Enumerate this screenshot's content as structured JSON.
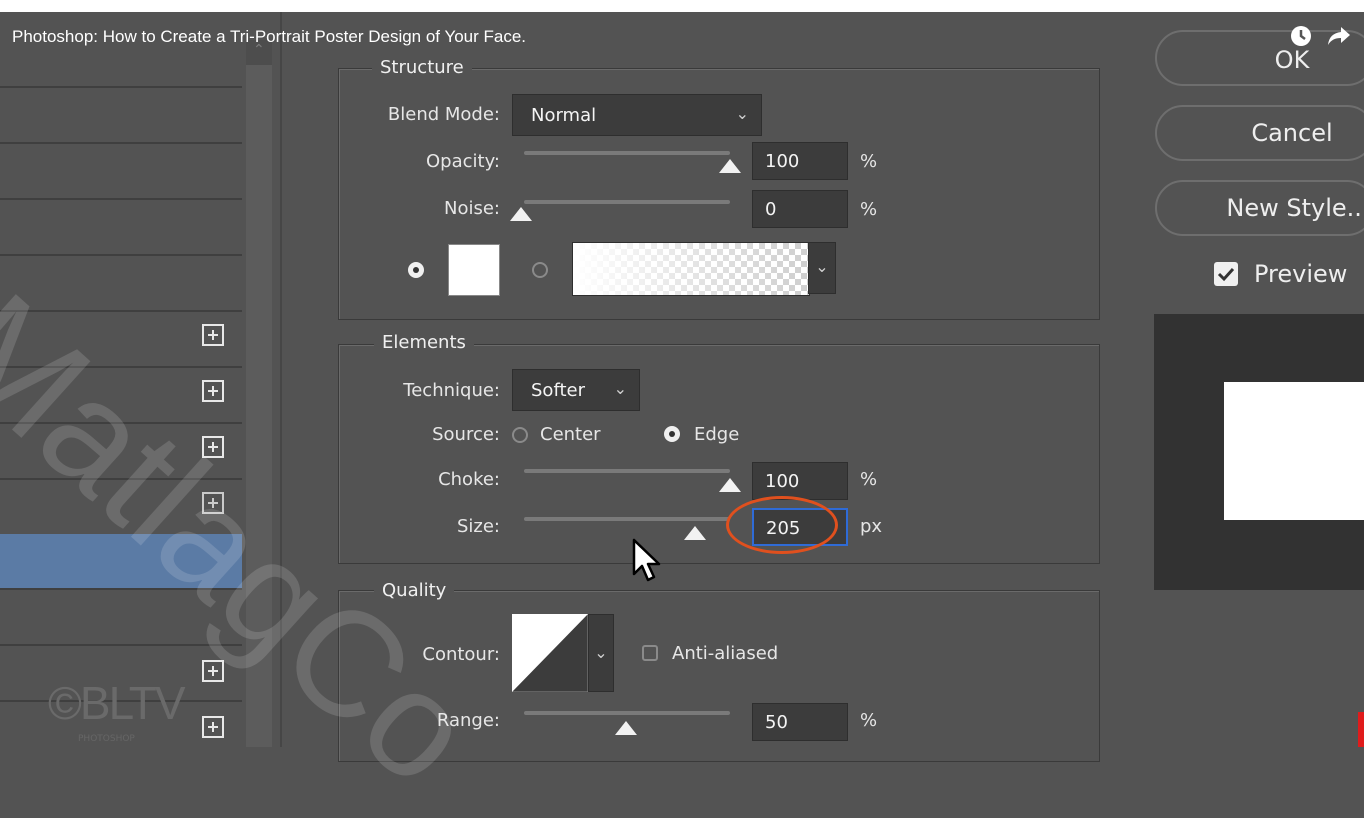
{
  "video": {
    "title": "Photoshop: How to Create a Tri-Portrait Poster Design of Your Face.",
    "watch_later_icon": "clock-icon",
    "share_icon": "share-arrow-icon"
  },
  "structure": {
    "legend": "Structure",
    "blend_mode_label": "Blend Mode:",
    "blend_mode_value": "Normal",
    "opacity_label": "Opacity:",
    "opacity_value": "100",
    "opacity_unit": "%",
    "opacity_level": 1.0,
    "noise_label": "Noise:",
    "noise_value": "0",
    "noise_unit": "%",
    "noise_level": 0.0
  },
  "elements": {
    "legend": "Elements",
    "technique_label": "Technique:",
    "technique_value": "Softer",
    "source_label": "Source:",
    "source_center": "Center",
    "source_edge": "Edge",
    "source_selected": "Edge",
    "choke_label": "Choke:",
    "choke_value": "100",
    "choke_unit": "%",
    "choke_level": 1.0,
    "size_label": "Size:",
    "size_value": "205",
    "size_unit": "px",
    "size_level": 0.85
  },
  "quality": {
    "legend": "Quality",
    "contour_label": "Contour:",
    "anti_aliased_label": "Anti-aliased",
    "anti_aliased_checked": false,
    "range_label": "Range:",
    "range_value": "50",
    "range_unit": "%",
    "range_level": 0.5
  },
  "buttons": {
    "ok": "OK",
    "cancel": "Cancel",
    "new_style": "New Style...",
    "preview_label": "Preview",
    "preview_checked": true
  },
  "watermark": {
    "logo_text": "©BLTV",
    "logo_sub": "PHOTOSHOP",
    "diagonal_text": "MatlagCo"
  },
  "colors": {
    "panel_bg": "#535353",
    "selected_row": "#5b7ba5",
    "highlight_ring": "#e0501e",
    "focus_border": "#2f6bd6"
  }
}
